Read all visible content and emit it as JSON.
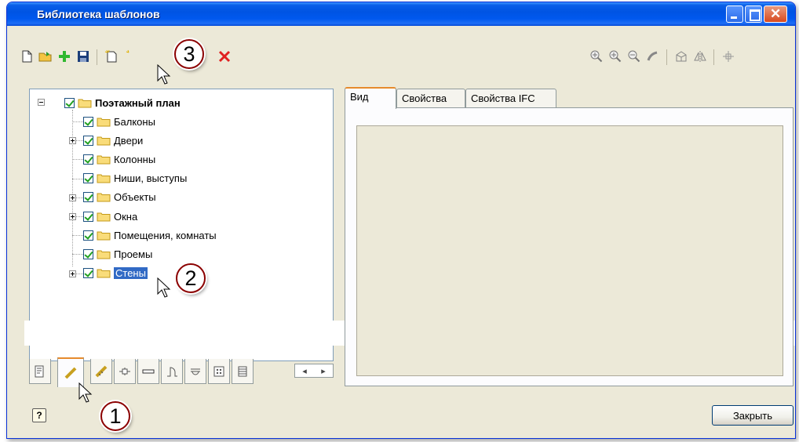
{
  "window": {
    "title": "Библиотека шаблонов"
  },
  "tree": {
    "root": "Поэтажный план",
    "items": [
      {
        "label": "Балконы",
        "expandable": false
      },
      {
        "label": "Двери",
        "expandable": true
      },
      {
        "label": "Колонны",
        "expandable": false
      },
      {
        "label": "Ниши, выступы",
        "expandable": false
      },
      {
        "label": "Объекты",
        "expandable": true
      },
      {
        "label": "Окна",
        "expandable": true
      },
      {
        "label": "Помещения, комнаты",
        "expandable": false
      },
      {
        "label": "Проемы",
        "expandable": false
      },
      {
        "label": "Стены",
        "expandable": true,
        "selected": true
      }
    ]
  },
  "right_tabs": [
    "Вид",
    "Свойства",
    "Свойства IFC"
  ],
  "buttons": {
    "close": "Закрыть",
    "help": "?"
  },
  "callouts": [
    "1",
    "2",
    "3"
  ],
  "colors": {
    "titlebar": "#0054e3",
    "selection": "#316ac5",
    "tab_accent": "#e68b2c",
    "window_bg": "#ece9d8"
  }
}
